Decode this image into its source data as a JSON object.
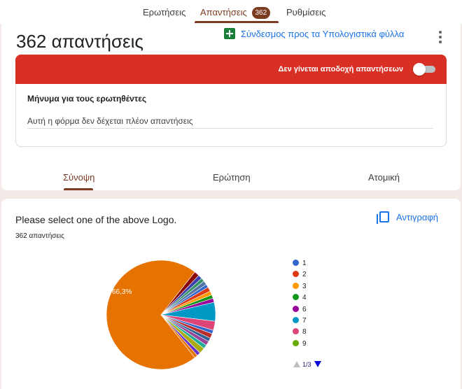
{
  "nav": {
    "tabs": [
      {
        "label": "Ερωτήσεις"
      },
      {
        "label": "Απαντήσεις",
        "badge": "362"
      },
      {
        "label": "Ρυθμίσεις"
      }
    ]
  },
  "summary": {
    "title": "362 απαντήσεις",
    "sheets_link": "Σύνδεσμος προς τα Υπολογιστικά φύλλα",
    "banner_text": "Δεν γίνεται αποδοχή απαντήσεων",
    "accepting_responses": false,
    "message_label": "Μήνυμα για τους ερωτηθέντες",
    "message_value": "Αυτή η φόρμα δεν δέχεται πλέον απαντήσεις"
  },
  "subtabs": [
    "Σύνοψη",
    "Ερώτηση",
    "Ατομική"
  ],
  "question": {
    "title": "Please select one of the above Logo.",
    "count": "362 απαντήσεις",
    "copy_label": "Αντιγραφή",
    "pager": "1/3"
  },
  "colors": {
    "accent": "#7b3b20",
    "banner": "#d93025",
    "link": "#1a73e8"
  },
  "chart_data": {
    "type": "pie",
    "slice_labels": [
      "66,3%"
    ],
    "legend": [
      {
        "label": "1",
        "color": "#3366cc"
      },
      {
        "label": "2",
        "color": "#dc3912"
      },
      {
        "label": "3",
        "color": "#ff9900"
      },
      {
        "label": "4",
        "color": "#109618"
      },
      {
        "label": "6",
        "color": "#990099"
      },
      {
        "label": "7",
        "color": "#0099c6"
      },
      {
        "label": "8",
        "color": "#dd4477"
      },
      {
        "label": "9",
        "color": "#66aa00"
      }
    ],
    "slices": [
      {
        "value": 66.3,
        "color": "#e67300"
      },
      {
        "value": 1.4,
        "color": "#8b0707"
      },
      {
        "value": 1.1,
        "color": "#3b3eac"
      },
      {
        "value": 1.0,
        "color": "#329262"
      },
      {
        "value": 1.1,
        "color": "#5574a6"
      },
      {
        "value": 0.9,
        "color": "#3366cc"
      },
      {
        "value": 1.2,
        "color": "#dc3912"
      },
      {
        "value": 1.1,
        "color": "#ff9900"
      },
      {
        "value": 1.0,
        "color": "#109618"
      },
      {
        "value": 1.1,
        "color": "#990099"
      },
      {
        "value": 5.2,
        "color": "#0099c6"
      },
      {
        "value": 2.5,
        "color": "#dd4477"
      },
      {
        "value": 1.0,
        "color": "#3366cc"
      },
      {
        "value": 1.3,
        "color": "#b82e2e"
      },
      {
        "value": 1.0,
        "color": "#316395"
      },
      {
        "value": 1.2,
        "color": "#994499"
      },
      {
        "value": 1.1,
        "color": "#22aa99"
      },
      {
        "value": 1.6,
        "color": "#aaaa11"
      },
      {
        "value": 1.0,
        "color": "#6633cc"
      },
      {
        "value": 0.9,
        "color": "#e67300"
      }
    ]
  }
}
